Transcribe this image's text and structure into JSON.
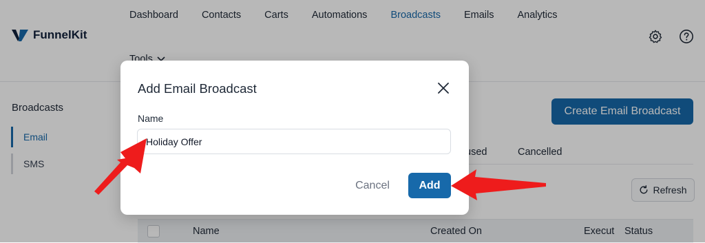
{
  "brand": {
    "name": "FunnelKit"
  },
  "nav": {
    "items": [
      {
        "label": "Dashboard"
      },
      {
        "label": "Contacts"
      },
      {
        "label": "Carts"
      },
      {
        "label": "Automations"
      },
      {
        "label": "Broadcasts",
        "active": true
      },
      {
        "label": "Emails"
      },
      {
        "label": "Analytics"
      }
    ],
    "tools_label": "Tools"
  },
  "header_icons": [
    "gear-icon",
    "help-icon"
  ],
  "sidebar": {
    "title": "Broadcasts",
    "items": [
      {
        "label": "Email",
        "active": true
      },
      {
        "label": "SMS"
      }
    ]
  },
  "main": {
    "create_button": "Create Email Broadcast",
    "tabs_visible": [
      "used",
      "Cancelled"
    ],
    "refresh_button": "Refresh",
    "table_headers": [
      "Name",
      "Created On",
      "Execut",
      "Status"
    ]
  },
  "modal": {
    "title": "Add Email Broadcast",
    "name_label": "Name",
    "name_value": "Holiday Offer",
    "cancel_label": "Cancel",
    "add_label": "Add"
  },
  "colors": {
    "accent": "#1769aa",
    "annotation_arrow": "#ee1c1c"
  }
}
